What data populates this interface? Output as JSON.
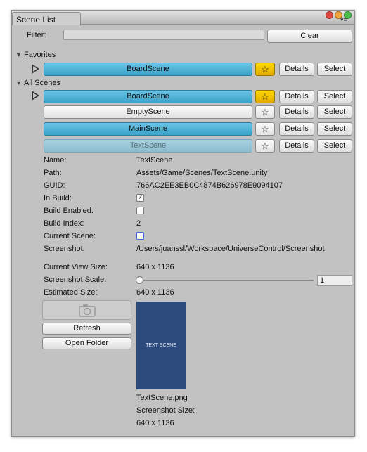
{
  "window": {
    "tab_title": "Scene List",
    "traffic_colors": [
      "#e04b43",
      "#f0a53b",
      "#4cc04b"
    ]
  },
  "filter": {
    "label": "Filter:",
    "value": "",
    "clear_label": "Clear"
  },
  "favorites": {
    "header": "Favorites",
    "items": [
      {
        "name": "BoardScene",
        "starred": true,
        "details": "Details",
        "select": "Select"
      }
    ]
  },
  "all_scenes": {
    "header": "All Scenes",
    "items": [
      {
        "name": "BoardScene",
        "starred": true,
        "details": "Details",
        "select": "Select"
      },
      {
        "name": "EmptyScene",
        "starred": false,
        "details": "Details",
        "select": "Select"
      },
      {
        "name": "MainScene",
        "starred": false,
        "details": "Details",
        "select": "Select"
      },
      {
        "name": "TextScene",
        "starred": false,
        "details": "Details",
        "select": "Select"
      }
    ]
  },
  "details": {
    "name_label": "Name:",
    "name_value": "TextScene",
    "path_label": "Path:",
    "path_value": "Assets/Game/Scenes/TextScene.unity",
    "guid_label": "GUID:",
    "guid_value": "766AC2EE3EB0C4874B626978E9094107",
    "in_build_label": "In Build:",
    "in_build": true,
    "build_enabled_label": "Build Enabled:",
    "build_enabled": false,
    "build_index_label": "Build Index:",
    "build_index_value": "2",
    "current_scene_label": "Current Scene:",
    "current_scene": false,
    "screenshot_label": "Screenshot:",
    "screenshot_value": "/Users/juanssl/Workspace/UniverseControl/Screenshot"
  },
  "screenshot": {
    "current_view_size_label": "Current View Size:",
    "current_view_size_value": "640 x 1136",
    "scale_label": "Screenshot Scale:",
    "scale_value": "1",
    "scale_fraction": 0.0,
    "estimated_size_label": "Estimated Size:",
    "estimated_size_value": "640 x 1136",
    "camera_icon": "camera-icon",
    "refresh_label": "Refresh",
    "open_folder_label": "Open Folder",
    "preview_text": "TEXT SCENE",
    "file_name": "TextScene.png",
    "size_label": "Screenshot Size:",
    "size_value": "640 x 1136"
  }
}
